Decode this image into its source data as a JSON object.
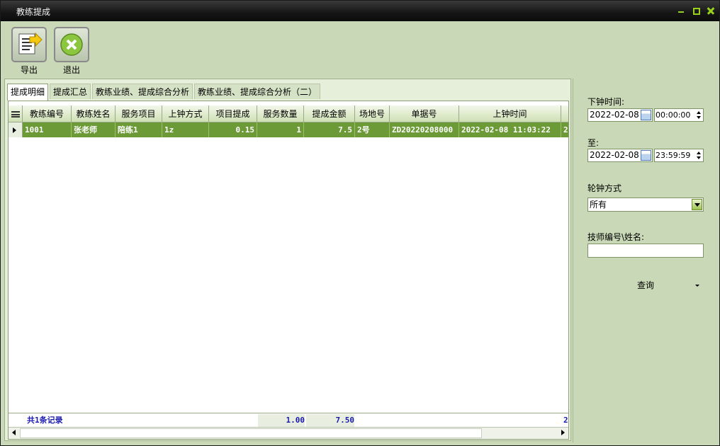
{
  "window": {
    "title": "教练提成",
    "controls": [
      "minimize-icon",
      "maximize-icon",
      "close-icon"
    ]
  },
  "toolbar": {
    "export_label": "导出",
    "exit_label": "退出"
  },
  "tabs": [
    {
      "label": "提成明细",
      "active": true
    },
    {
      "label": "提成汇总",
      "active": false
    },
    {
      "label": "教练业绩、提成综合分析",
      "active": false
    },
    {
      "label": "教练业绩、提成综合分析（二）",
      "active": false
    }
  ],
  "grid": {
    "columns": [
      "教练编号",
      "教练姓名",
      "服务项目",
      "上钟方式",
      "项目提成",
      "服务数量",
      "提成金额",
      "场地号",
      "单据号",
      "上钟时间",
      ""
    ],
    "rows": [
      [
        "1001",
        "张老师",
        "陪练1",
        "1z",
        "0.15",
        "1",
        "7.5",
        "2号",
        "ZD20220208000",
        "2022-02-08 11:03:22",
        "2"
      ]
    ],
    "footer": {
      "count": "共1条记录",
      "sum_commission": "1.00",
      "sum_amount": "7.50",
      "trailing": "2"
    }
  },
  "filters": {
    "start_label": "下钟时间:",
    "start_date": "2022-02-08",
    "start_time": "00:00:00",
    "end_label": "至:",
    "end_date": "2022-02-08",
    "end_time": "23:59:59",
    "mode_label": "轮钟方式",
    "mode_value": "所有",
    "tech_label": "技师编号\\姓名:",
    "tech_value": "",
    "query_label": "查询"
  },
  "colors": {
    "row_selected": "#6b9a36",
    "panel_bg": "#c9d8b6",
    "footer_text": "#1a1ab0"
  }
}
